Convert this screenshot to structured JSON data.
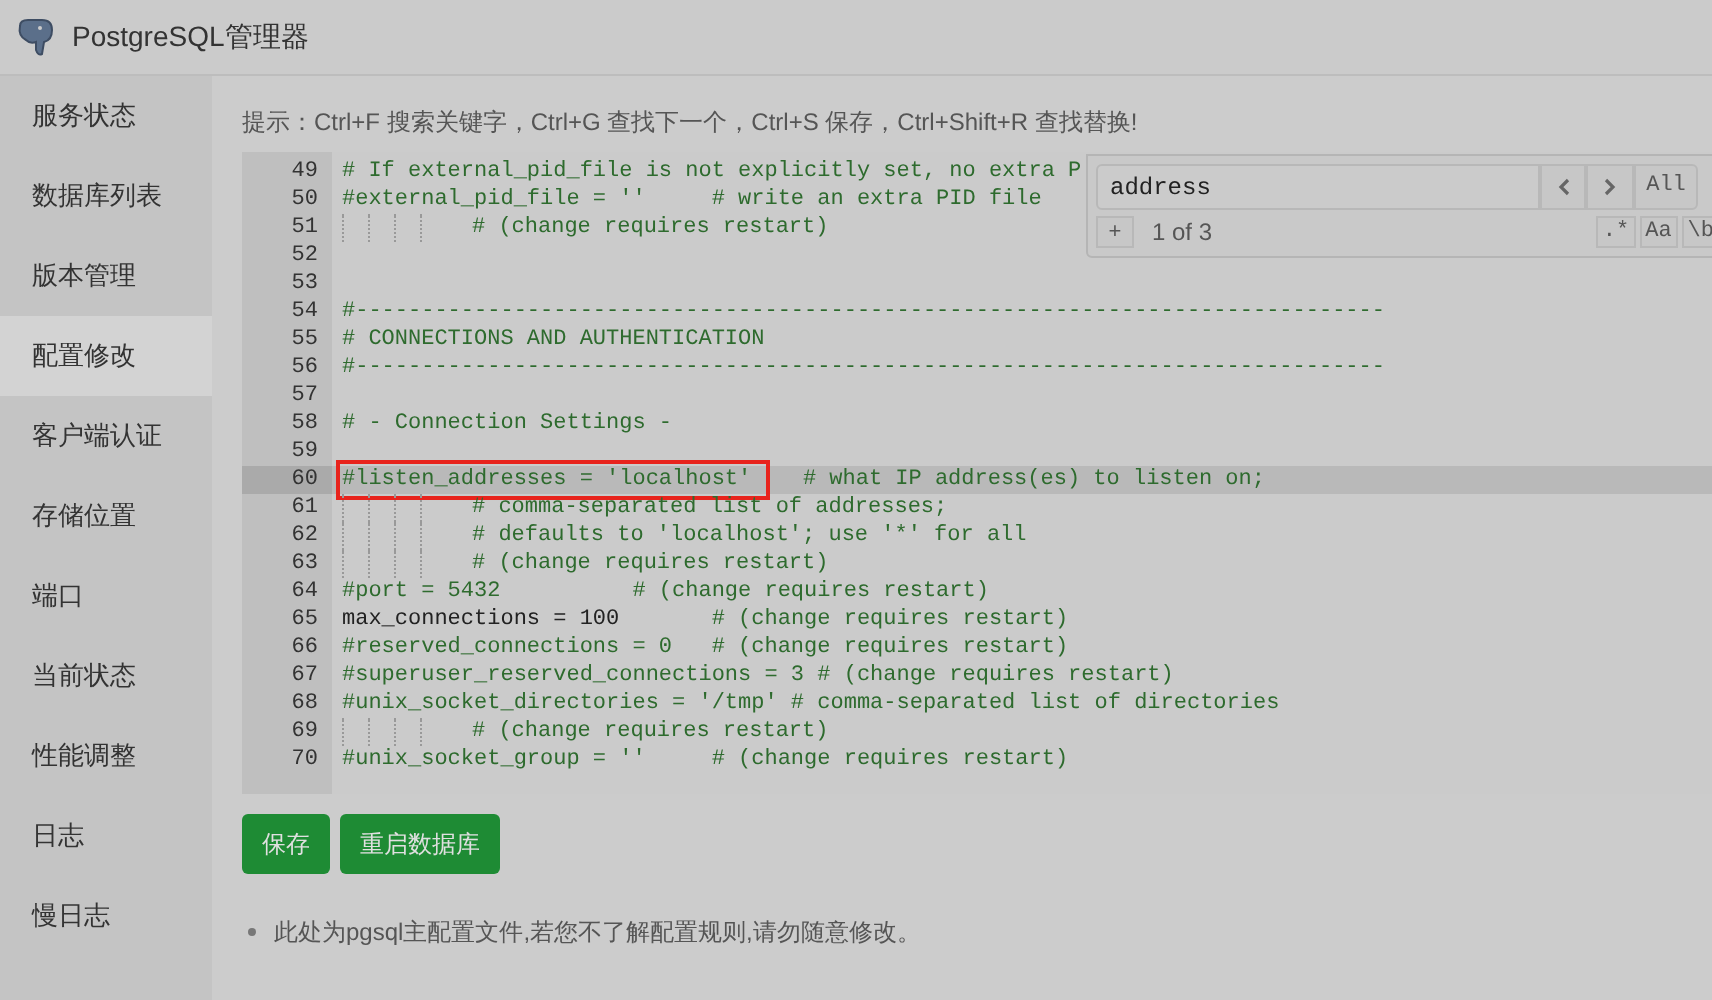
{
  "window": {
    "title": "PostgreSQL管理器"
  },
  "sidebar": {
    "items": [
      {
        "label": "服务状态",
        "selected": false
      },
      {
        "label": "数据库列表",
        "selected": false
      },
      {
        "label": "版本管理",
        "selected": false
      },
      {
        "label": "配置修改",
        "selected": true
      },
      {
        "label": "客户端认证",
        "selected": false
      },
      {
        "label": "存储位置",
        "selected": false
      },
      {
        "label": "端口",
        "selected": false
      },
      {
        "label": "当前状态",
        "selected": false
      },
      {
        "label": "性能调整",
        "selected": false
      },
      {
        "label": "日志",
        "selected": false
      },
      {
        "label": "慢日志",
        "selected": false
      }
    ]
  },
  "hint": "提示：Ctrl+F 搜索关键字，Ctrl+G 查找下一个，Ctrl+S 保存，Ctrl+Shift+R 查找替换!",
  "editor": {
    "lines": [
      {
        "num": "49",
        "current": false,
        "indent": false,
        "segments": [
          {
            "kind": "comment",
            "text": "# If external_pid_file is not explicitly set, no extra P",
            "boxed": false
          }
        ]
      },
      {
        "num": "50",
        "current": false,
        "indent": false,
        "segments": [
          {
            "kind": "comment",
            "text": "#external_pid_file = ''     # write an extra PID file",
            "boxed": false
          }
        ]
      },
      {
        "num": "51",
        "current": false,
        "indent": true,
        "segments": [
          {
            "kind": "comment",
            "text": "# (change requires restart)",
            "boxed": false
          }
        ]
      },
      {
        "num": "52",
        "current": false,
        "indent": false
      },
      {
        "num": "53",
        "current": false,
        "indent": false
      },
      {
        "num": "54",
        "current": false,
        "indent": false,
        "segments": [
          {
            "kind": "comment",
            "text": "#------------------------------------------------------------------------------",
            "boxed": false
          }
        ]
      },
      {
        "num": "55",
        "current": false,
        "indent": false,
        "segments": [
          {
            "kind": "comment",
            "text": "# CONNECTIONS AND AUTHENTICATION",
            "boxed": false
          }
        ]
      },
      {
        "num": "56",
        "current": false,
        "indent": false,
        "segments": [
          {
            "kind": "comment",
            "text": "#------------------------------------------------------------------------------",
            "boxed": false
          }
        ]
      },
      {
        "num": "57",
        "current": false,
        "indent": false
      },
      {
        "num": "58",
        "current": false,
        "indent": false,
        "segments": [
          {
            "kind": "comment",
            "text": "# - Connection Settings -",
            "boxed": false
          }
        ]
      },
      {
        "num": "59",
        "current": false,
        "indent": false
      },
      {
        "num": "60",
        "current": true,
        "indent": false,
        "segments": [
          {
            "kind": "comment",
            "text": "#listen_addresses = 'localhost'",
            "boxed": true
          },
          {
            "kind": "comment",
            "text": "   # what IP address(es) to listen on;",
            "boxed": false
          }
        ]
      },
      {
        "num": "61",
        "current": false,
        "indent": true,
        "segments": [
          {
            "kind": "comment",
            "text": "# comma-separated list of addresses;",
            "boxed": false
          }
        ]
      },
      {
        "num": "62",
        "current": false,
        "indent": true,
        "segments": [
          {
            "kind": "comment",
            "text": "# defaults to 'localhost'; use '*' for all",
            "boxed": false
          }
        ]
      },
      {
        "num": "63",
        "current": false,
        "indent": true,
        "segments": [
          {
            "kind": "comment",
            "text": "# (change requires restart)",
            "boxed": false
          }
        ]
      },
      {
        "num": "64",
        "current": false,
        "indent": false,
        "segments": [
          {
            "kind": "comment",
            "text": "#port = 5432          # (change requires restart)",
            "boxed": false
          }
        ]
      },
      {
        "num": "65",
        "current": false,
        "indent": false,
        "segments": [
          {
            "kind": "code",
            "text": "max_connections = 100",
            "boxed": false
          },
          {
            "kind": "comment",
            "text": "       # (change requires restart)",
            "boxed": false
          }
        ]
      },
      {
        "num": "66",
        "current": false,
        "indent": false,
        "segments": [
          {
            "kind": "comment",
            "text": "#reserved_connections = 0   # (change requires restart)",
            "boxed": false
          }
        ]
      },
      {
        "num": "67",
        "current": false,
        "indent": false,
        "segments": [
          {
            "kind": "comment",
            "text": "#superuser_reserved_connections = 3 # (change requires restart)",
            "boxed": false
          }
        ]
      },
      {
        "num": "68",
        "current": false,
        "indent": false,
        "segments": [
          {
            "kind": "comment",
            "text": "#unix_socket_directories = '/tmp' # comma-separated list of directories",
            "boxed": false
          }
        ]
      },
      {
        "num": "69",
        "current": false,
        "indent": true,
        "segments": [
          {
            "kind": "comment",
            "text": "# (change requires restart)",
            "boxed": false
          }
        ]
      },
      {
        "num": "70",
        "current": false,
        "indent": false,
        "segments": [
          {
            "kind": "comment",
            "text": "#unix_socket_group = ''     # (change requires restart)",
            "boxed": false
          }
        ]
      }
    ]
  },
  "search": {
    "value": "address",
    "all_label": "All",
    "add_label": "+",
    "count": "1 of 3",
    "toggles": [
      {
        "label": ".*"
      },
      {
        "label": "Aa"
      },
      {
        "label": "\\b"
      }
    ]
  },
  "buttons": [
    {
      "label": "保存"
    },
    {
      "label": "重启数据库"
    }
  ],
  "note": "此处为pgsql主配置文件,若您不了解配置规则,请勿随意修改。"
}
